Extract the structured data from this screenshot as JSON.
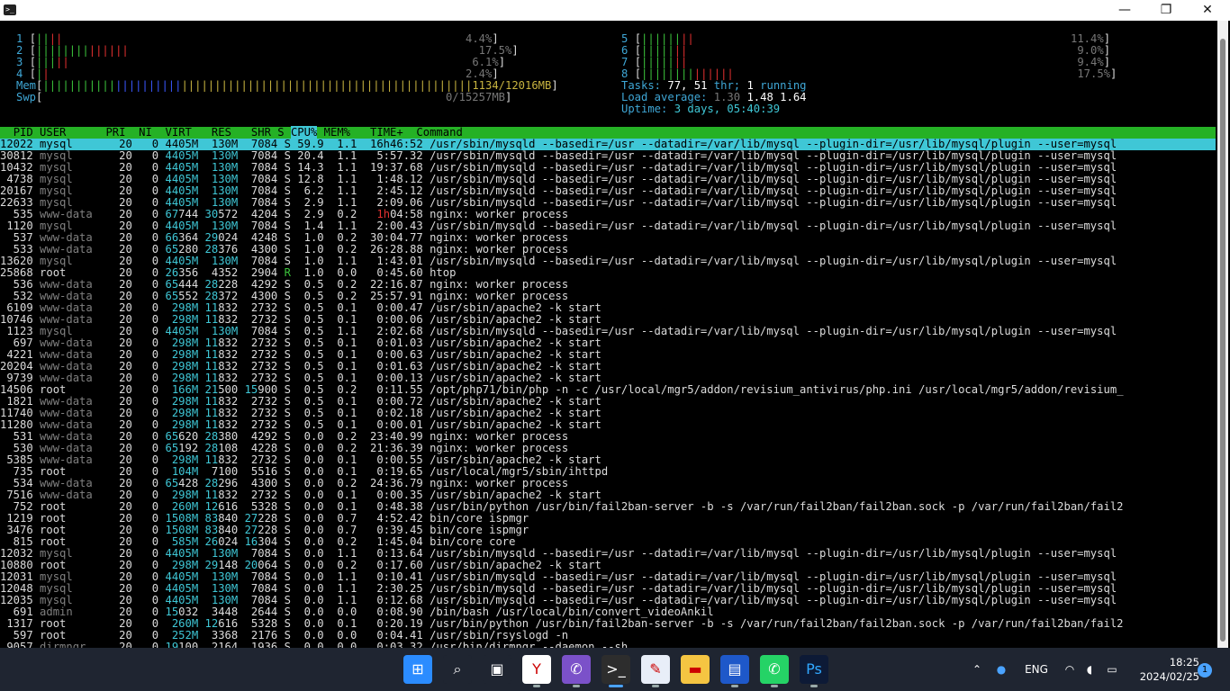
{
  "window": {
    "icon": "terminal-icon",
    "controls": {
      "minimize": "—",
      "maximize": "❐",
      "close": "✕"
    }
  },
  "meters_left": [
    {
      "label": "1",
      "pct": "4.4%"
    },
    {
      "label": "2",
      "pct": "17.5%"
    },
    {
      "label": "3",
      "pct": "6.1%"
    },
    {
      "label": "4",
      "pct": "2.4%"
    }
  ],
  "meters_right": [
    {
      "label": "5",
      "pct": "11.4%"
    },
    {
      "label": "6",
      "pct": "9.0%"
    },
    {
      "label": "7",
      "pct": "9.4%"
    },
    {
      "label": "8",
      "pct": "17.5%"
    }
  ],
  "mem": {
    "label": "Mem",
    "value": "1134/12016MB"
  },
  "swp": {
    "label": "Swp",
    "value": "0/15257MB"
  },
  "tasks": {
    "label": "Tasks:",
    "total": "77,",
    "thr": "51",
    "thr_label": "thr;",
    "running": "1",
    "running_label": "running"
  },
  "load": {
    "label": "Load average:",
    "l1": "1.30",
    "l5": "1.48",
    "l15": "1.64"
  },
  "uptime": {
    "label": "Uptime:",
    "value": "3 days, 05:40:39"
  },
  "columns": {
    "pid": "PID",
    "user": "USER",
    "pri": "PRI",
    "ni": "NI",
    "virt": "VIRT",
    "res": "RES",
    "shr": "SHR",
    "s": "S",
    "cpu": "CPU%",
    "mem": "MEM%",
    "time": "TIME+",
    "cmd": "Command"
  },
  "processes": [
    [
      "12022",
      "mysql",
      "20",
      "0",
      "4405M",
      "130M",
      "7084",
      "S",
      "59.9",
      "1.1",
      "16h46:52",
      "/usr/sbin/mysqld --basedir=/usr --datadir=/var/lib/mysql --plugin-dir=/usr/lib/mysql/plugin --user=mysql"
    ],
    [
      "30812",
      "mysql",
      "20",
      "0",
      "4405M",
      "130M",
      "7084",
      "S",
      "20.4",
      "1.1",
      "5:57.32",
      "/usr/sbin/mysqld --basedir=/usr --datadir=/var/lib/mysql --plugin-dir=/usr/lib/mysql/plugin --user=mysql"
    ],
    [
      "10432",
      "mysql",
      "20",
      "0",
      "4405M",
      "130M",
      "7084",
      "S",
      "14.3",
      "1.1",
      "19:37.68",
      "/usr/sbin/mysqld --basedir=/usr --datadir=/var/lib/mysql --plugin-dir=/usr/lib/mysql/plugin --user=mysql"
    ],
    [
      "4738",
      "mysql",
      "20",
      "0",
      "4405M",
      "130M",
      "7084",
      "S",
      "12.8",
      "1.1",
      "1:48.12",
      "/usr/sbin/mysqld --basedir=/usr --datadir=/var/lib/mysql --plugin-dir=/usr/lib/mysql/plugin --user=mysql"
    ],
    [
      "20167",
      "mysql",
      "20",
      "0",
      "4405M",
      "130M",
      "7084",
      "S",
      "6.2",
      "1.1",
      "2:45.12",
      "/usr/sbin/mysqld --basedir=/usr --datadir=/var/lib/mysql --plugin-dir=/usr/lib/mysql/plugin --user=mysql"
    ],
    [
      "22633",
      "mysql",
      "20",
      "0",
      "4405M",
      "130M",
      "7084",
      "S",
      "2.9",
      "1.1",
      "2:09.06",
      "/usr/sbin/mysqld --basedir=/usr --datadir=/var/lib/mysql --plugin-dir=/usr/lib/mysql/plugin --user=mysql"
    ],
    [
      "535",
      "www-data",
      "20",
      "0",
      "67744",
      "30572",
      "4204",
      "S",
      "2.9",
      "0.2",
      "1h04:58",
      "nginx: worker process"
    ],
    [
      "1120",
      "mysql",
      "20",
      "0",
      "4405M",
      "130M",
      "7084",
      "S",
      "1.4",
      "1.1",
      "2:00.43",
      "/usr/sbin/mysqld --basedir=/usr --datadir=/var/lib/mysql --plugin-dir=/usr/lib/mysql/plugin --user=mysql"
    ],
    [
      "537",
      "www-data",
      "20",
      "0",
      "66364",
      "29024",
      "4248",
      "S",
      "1.0",
      "0.2",
      "30:04.77",
      "nginx: worker process"
    ],
    [
      "533",
      "www-data",
      "20",
      "0",
      "65280",
      "28376",
      "4300",
      "S",
      "1.0",
      "0.2",
      "26:28.88",
      "nginx: worker process"
    ],
    [
      "13620",
      "mysql",
      "20",
      "0",
      "4405M",
      "130M",
      "7084",
      "S",
      "1.0",
      "1.1",
      "1:43.01",
      "/usr/sbin/mysqld --basedir=/usr --datadir=/var/lib/mysql --plugin-dir=/usr/lib/mysql/plugin --user=mysql"
    ],
    [
      "25868",
      "root",
      "20",
      "0",
      "26356",
      "4352",
      "2904",
      "R",
      "1.0",
      "0.0",
      "0:45.60",
      "htop"
    ],
    [
      "536",
      "www-data",
      "20",
      "0",
      "65444",
      "28228",
      "4292",
      "S",
      "0.5",
      "0.2",
      "22:16.87",
      "nginx: worker process"
    ],
    [
      "532",
      "www-data",
      "20",
      "0",
      "65552",
      "28372",
      "4300",
      "S",
      "0.5",
      "0.2",
      "25:57.91",
      "nginx: worker process"
    ],
    [
      "6109",
      "www-data",
      "20",
      "0",
      "298M",
      "11832",
      "2732",
      "S",
      "0.5",
      "0.1",
      "0:00.47",
      "/usr/sbin/apache2 -k start"
    ],
    [
      "10746",
      "www-data",
      "20",
      "0",
      "298M",
      "11832",
      "2732",
      "S",
      "0.5",
      "0.1",
      "0:00.06",
      "/usr/sbin/apache2 -k start"
    ],
    [
      "1123",
      "mysql",
      "20",
      "0",
      "4405M",
      "130M",
      "7084",
      "S",
      "0.5",
      "1.1",
      "2:02.68",
      "/usr/sbin/mysqld --basedir=/usr --datadir=/var/lib/mysql --plugin-dir=/usr/lib/mysql/plugin --user=mysql"
    ],
    [
      "697",
      "www-data",
      "20",
      "0",
      "298M",
      "11832",
      "2732",
      "S",
      "0.5",
      "0.1",
      "0:01.03",
      "/usr/sbin/apache2 -k start"
    ],
    [
      "4221",
      "www-data",
      "20",
      "0",
      "298M",
      "11832",
      "2732",
      "S",
      "0.5",
      "0.1",
      "0:00.63",
      "/usr/sbin/apache2 -k start"
    ],
    [
      "20204",
      "www-data",
      "20",
      "0",
      "298M",
      "11832",
      "2732",
      "S",
      "0.5",
      "0.1",
      "0:01.63",
      "/usr/sbin/apache2 -k start"
    ],
    [
      "9739",
      "www-data",
      "20",
      "0",
      "298M",
      "11832",
      "2732",
      "S",
      "0.5",
      "0.1",
      "0:00.13",
      "/usr/sbin/apache2 -k start"
    ],
    [
      "14506",
      "root",
      "20",
      "0",
      "166M",
      "21500",
      "15900",
      "S",
      "0.5",
      "0.2",
      "0:11.55",
      "/opt/php71/bin/php -n -c /usr/local/mgr5/addon/revisium_antivirus/php.ini /usr/local/mgr5/addon/revisium_"
    ],
    [
      "1821",
      "www-data",
      "20",
      "0",
      "298M",
      "11832",
      "2732",
      "S",
      "0.5",
      "0.1",
      "0:00.72",
      "/usr/sbin/apache2 -k start"
    ],
    [
      "11740",
      "www-data",
      "20",
      "0",
      "298M",
      "11832",
      "2732",
      "S",
      "0.5",
      "0.1",
      "0:02.18",
      "/usr/sbin/apache2 -k start"
    ],
    [
      "11280",
      "www-data",
      "20",
      "0",
      "298M",
      "11832",
      "2732",
      "S",
      "0.5",
      "0.1",
      "0:00.01",
      "/usr/sbin/apache2 -k start"
    ],
    [
      "531",
      "www-data",
      "20",
      "0",
      "65620",
      "28380",
      "4292",
      "S",
      "0.0",
      "0.2",
      "23:40.99",
      "nginx: worker process"
    ],
    [
      "530",
      "www-data",
      "20",
      "0",
      "65192",
      "28108",
      "4228",
      "S",
      "0.0",
      "0.2",
      "21:36.39",
      "nginx: worker process"
    ],
    [
      "5385",
      "www-data",
      "20",
      "0",
      "298M",
      "11832",
      "2732",
      "S",
      "0.0",
      "0.1",
      "0:00.55",
      "/usr/sbin/apache2 -k start"
    ],
    [
      "735",
      "root",
      "20",
      "0",
      "104M",
      "7100",
      "5516",
      "S",
      "0.0",
      "0.1",
      "0:19.65",
      "/usr/local/mgr5/sbin/ihttpd"
    ],
    [
      "534",
      "www-data",
      "20",
      "0",
      "65428",
      "28296",
      "4300",
      "S",
      "0.0",
      "0.2",
      "24:36.79",
      "nginx: worker process"
    ],
    [
      "7516",
      "www-data",
      "20",
      "0",
      "298M",
      "11832",
      "2732",
      "S",
      "0.0",
      "0.1",
      "0:00.35",
      "/usr/sbin/apache2 -k start"
    ],
    [
      "752",
      "root",
      "20",
      "0",
      "260M",
      "12616",
      "5328",
      "S",
      "0.0",
      "0.1",
      "0:48.38",
      "/usr/bin/python /usr/bin/fail2ban-server -b -s /var/run/fail2ban/fail2ban.sock -p /var/run/fail2ban/fail2"
    ],
    [
      "1219",
      "root",
      "20",
      "0",
      "1508M",
      "83840",
      "27228",
      "S",
      "0.0",
      "0.7",
      "4:52.42",
      "bin/core ispmgr"
    ],
    [
      "3476",
      "root",
      "20",
      "0",
      "1508M",
      "83840",
      "27228",
      "S",
      "0.0",
      "0.7",
      "0:39.45",
      "bin/core ispmgr"
    ],
    [
      "815",
      "root",
      "20",
      "0",
      "585M",
      "26024",
      "16304",
      "S",
      "0.0",
      "0.2",
      "1:45.04",
      "bin/core core"
    ],
    [
      "12032",
      "mysql",
      "20",
      "0",
      "4405M",
      "130M",
      "7084",
      "S",
      "0.0",
      "1.1",
      "0:13.64",
      "/usr/sbin/mysqld --basedir=/usr --datadir=/var/lib/mysql --plugin-dir=/usr/lib/mysql/plugin --user=mysql"
    ],
    [
      "10880",
      "root",
      "20",
      "0",
      "298M",
      "29148",
      "20064",
      "S",
      "0.0",
      "0.2",
      "0:17.60",
      "/usr/sbin/apache2 -k start"
    ],
    [
      "12031",
      "mysql",
      "20",
      "0",
      "4405M",
      "130M",
      "7084",
      "S",
      "0.0",
      "1.1",
      "0:10.41",
      "/usr/sbin/mysqld --basedir=/usr --datadir=/var/lib/mysql --plugin-dir=/usr/lib/mysql/plugin --user=mysql"
    ],
    [
      "12048",
      "mysql",
      "20",
      "0",
      "4405M",
      "130M",
      "7084",
      "S",
      "0.0",
      "1.1",
      "2:30.25",
      "/usr/sbin/mysqld --basedir=/usr --datadir=/var/lib/mysql --plugin-dir=/usr/lib/mysql/plugin --user=mysql"
    ],
    [
      "12035",
      "mysql",
      "20",
      "0",
      "4405M",
      "130M",
      "7084",
      "S",
      "0.0",
      "1.1",
      "0:12.68",
      "/usr/sbin/mysqld --basedir=/usr --datadir=/var/lib/mysql --plugin-dir=/usr/lib/mysql/plugin --user=mysql"
    ],
    [
      "691",
      "admin",
      "20",
      "0",
      "15032",
      "3448",
      "2644",
      "S",
      "0.0",
      "0.0",
      "0:08.90",
      "/bin/bash /usr/local/bin/convert_videoAnkil"
    ],
    [
      "1317",
      "root",
      "20",
      "0",
      "260M",
      "12616",
      "5328",
      "S",
      "0.0",
      "0.1",
      "0:20.19",
      "/usr/bin/python /usr/bin/fail2ban-server -b -s /var/run/fail2ban/fail2ban.sock -p /var/run/fail2ban/fail2"
    ],
    [
      "597",
      "root",
      "20",
      "0",
      "252M",
      "3368",
      "2176",
      "S",
      "0.0",
      "0.0",
      "0:04.41",
      "/usr/sbin/rsyslogd -n"
    ],
    [
      "9057",
      "dirmngr",
      "20",
      "0",
      "19100",
      "2164",
      "1936",
      "S",
      "0.0",
      "0.0",
      "0:03.32",
      "/usr/bin/dirmngr --daemon --sh"
    ]
  ],
  "taskbar": {
    "apps": [
      {
        "name": "windows-start-icon",
        "glyph": "⊞",
        "color": "#2b8cff"
      },
      {
        "name": "search-icon",
        "glyph": "⌕",
        "color": "#1f2531"
      },
      {
        "name": "task-view-icon",
        "glyph": "▣",
        "color": "#1f2531"
      },
      {
        "name": "yandex-browser-icon",
        "glyph": "Y",
        "color": "#ffffff"
      },
      {
        "name": "viber-icon",
        "glyph": "✆",
        "color": "#7b51c9"
      },
      {
        "name": "terminal-icon",
        "glyph": ">_",
        "color": "#2d2d2d"
      },
      {
        "name": "notepad-icon",
        "glyph": "✎",
        "color": "#e8eef8"
      },
      {
        "name": "file-explorer-icon",
        "glyph": "▬",
        "color": "#f5c542"
      },
      {
        "name": "save-disk-icon",
        "glyph": "▤",
        "color": "#1e58c9"
      },
      {
        "name": "whatsapp-icon",
        "glyph": "✆",
        "color": "#25d366"
      },
      {
        "name": "photoshop-icon",
        "glyph": "Ps",
        "color": "#0d1a36"
      }
    ],
    "tray": {
      "chevron": "⌃",
      "mic": "🎤",
      "lang": "ENG",
      "wifi": "◠",
      "volume": "🔊",
      "battery": "▭"
    },
    "time": "18:25",
    "date": "2024/02/25",
    "notifications": "1"
  }
}
